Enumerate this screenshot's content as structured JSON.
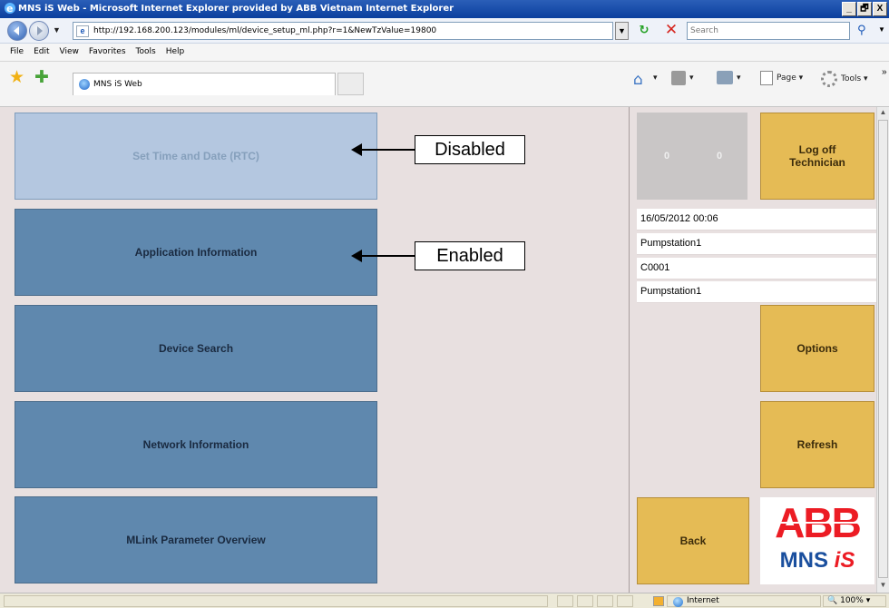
{
  "window": {
    "title": "MNS iS Web - Microsoft Internet Explorer provided by ABB Vietnam Internet Explorer",
    "buttons": [
      "_",
      "🗗",
      "X"
    ]
  },
  "address_bar": {
    "url": "http://192.168.200.123/modules/ml/device_setup_ml.php?r=1&NewTzValue=19800",
    "search_placeholder": "Search"
  },
  "menu": [
    "File",
    "Edit",
    "View",
    "Favorites",
    "Tools",
    "Help"
  ],
  "tab": {
    "label": "MNS iS Web"
  },
  "command_bar": {
    "page_label": "Page ▾",
    "tools_label": "Tools ▾"
  },
  "nav_buttons": [
    {
      "label": "Set Time and Date (RTC)",
      "state": "disabled"
    },
    {
      "label": "Application Information",
      "state": "enabled"
    },
    {
      "label": "Device Search",
      "state": "enabled"
    },
    {
      "label": "Network Information",
      "state": "enabled"
    },
    {
      "label": "MLink Parameter Overview",
      "state": "enabled"
    }
  ],
  "callouts": {
    "disabled": "Disabled",
    "enabled": "Enabled"
  },
  "sidebar": {
    "counter_left": "0",
    "counter_right": "0",
    "logoff_label": "Log off Technician",
    "info": [
      "16/05/2012 00:06",
      "Pumpstation1",
      "C0001",
      "Pumpstation1"
    ],
    "options_label": "Options",
    "refresh_label": "Refresh",
    "back_label": "Back",
    "logo_top": "ABB",
    "logo_bottom_1": "MNS",
    "logo_bottom_2": "iS"
  },
  "status_bar": {
    "zone": "Internet",
    "zoom": "100%"
  },
  "colors": {
    "enabled_button": "#5f88ae",
    "disabled_button": "#b4c7e0",
    "gold_button": "#e5bb55",
    "content_bg": "#e8e0e0",
    "abb_red": "#ec1c24"
  }
}
